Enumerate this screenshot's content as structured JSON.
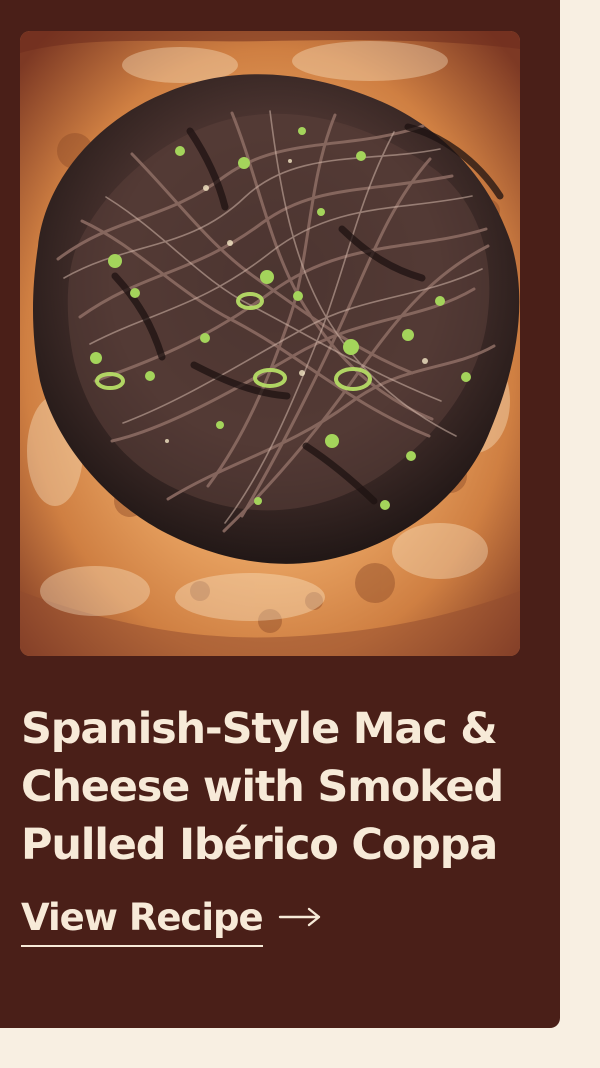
{
  "card": {
    "image": {
      "alt": "",
      "icon": "food-photo"
    },
    "title": "Spanish-Style Mac & Cheese with Smoked Pulled Ibérico Coppa",
    "cta": {
      "label": "View Recipe",
      "icon": "arrow-right-icon"
    }
  },
  "colors": {
    "page_background": "#f8efe2",
    "card_background": "#4a1f18",
    "text": "#f7ead8"
  }
}
